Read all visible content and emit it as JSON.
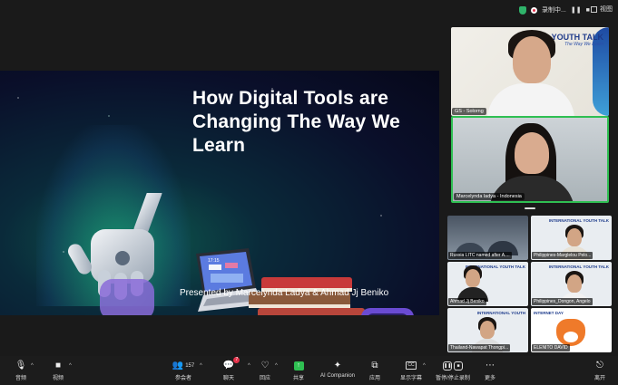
{
  "top_bar": {
    "recording_label": "录制中...",
    "view_label": "视图"
  },
  "slide": {
    "title": "How Digital Tools are Changing The Way We Learn",
    "presenter": "Presented by Marcelynda Ladya & Ahmad Jj Beniko",
    "laptop_clock": "17:15"
  },
  "speaker_tiles": [
    {
      "name": "GS - Solorng",
      "brand": "YOUTH TALK",
      "tagline": "The Way We Learn"
    },
    {
      "name": "Marcelynda ladya - Indonesia"
    }
  ],
  "gallery_tiles": [
    {
      "name": "Russia LITC named after A...."
    },
    {
      "name": "Philippines-Marglelou Pelo...",
      "brand": "INTERNATIONAL YOUTH TALK"
    },
    {
      "name": "Ahmad Jj Beniko",
      "brand": "INTERNATIONAL YOUTH TALK"
    },
    {
      "name": "Philippines_Dongon, Angelo",
      "brand": "INTERNATIONAL YOUTH TALK"
    },
    {
      "name": "Thailand-Nawapat Thongpi...",
      "brand": "INTERNATIONAL YOUTH"
    },
    {
      "name": "ELENITO DAVID",
      "brand": "INTERNET DAY"
    }
  ],
  "toolbar": {
    "audio": "音频",
    "video": "视频",
    "participants": "参会者",
    "participants_count": "157",
    "chat": "聊天",
    "chat_badge": "7",
    "reactions": "回应",
    "share": "共享",
    "ai_companion": "AI Companion",
    "apps": "应用",
    "captions": "显示字幕",
    "captions_icon": "CC",
    "record": "暂停/停止录制",
    "more": "更多",
    "leave": "离开"
  },
  "colors": {
    "active_speaker_border": "#2fbf52",
    "record_red": "#e5334b",
    "share_green": "#2fbf52",
    "toolbar_bg": "#1c1c1c"
  }
}
